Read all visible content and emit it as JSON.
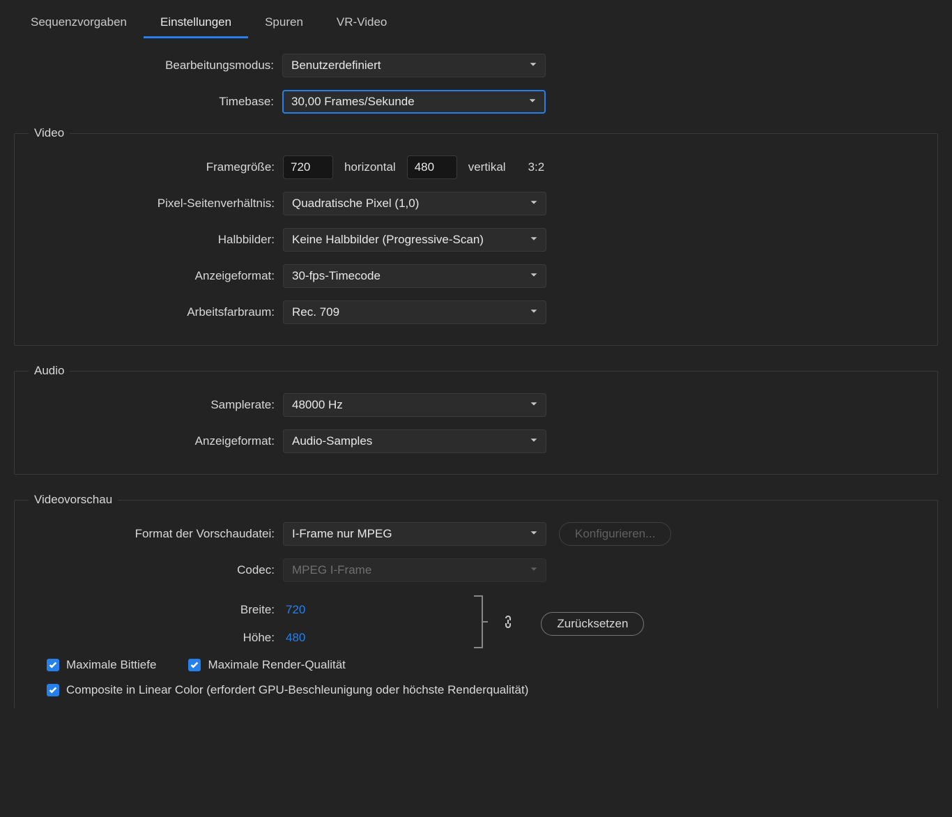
{
  "tabs": {
    "t0": "Sequenzvorgaben",
    "t1": "Einstellungen",
    "t2": "Spuren",
    "t3": "VR-Video"
  },
  "editing": {
    "mode_label": "Bearbeitungsmodus:",
    "mode_value": "Benutzerdefiniert",
    "timebase_label": "Timebase:",
    "timebase_value": "30,00  Frames/Sekunde"
  },
  "video": {
    "legend": "Video",
    "framesize_label": "Framegröße:",
    "width": "720",
    "horizontal": "horizontal",
    "height": "480",
    "vertical": "vertikal",
    "aspect": "3:2",
    "par_label": "Pixel-Seitenverhältnis:",
    "par_value": "Quadratische Pixel (1,0)",
    "fields_label": "Halbbilder:",
    "fields_value": "Keine Halbbilder (Progressive-Scan)",
    "display_label": "Anzeigeformat:",
    "display_value": "30-fps-Timecode",
    "colorspace_label": "Arbeitsfarbraum:",
    "colorspace_value": "Rec. 709"
  },
  "audio": {
    "legend": "Audio",
    "samplerate_label": "Samplerate:",
    "samplerate_value": "48000 Hz",
    "display_label": "Anzeigeformat:",
    "display_value": "Audio-Samples"
  },
  "preview": {
    "legend": "Videovorschau",
    "format_label": "Format der Vorschaudatei:",
    "format_value": "I-Frame nur MPEG",
    "configure": "Konfigurieren...",
    "codec_label": "Codec:",
    "codec_value": "MPEG I-Frame",
    "width_label": "Breite:",
    "width_value": "720",
    "height_label": "Höhe:",
    "height_value": "480",
    "reset": "Zurücksetzen"
  },
  "checks": {
    "bitdepth": "Maximale Bittiefe",
    "renderq": "Maximale Render-Qualität",
    "linear": "Composite in Linear Color (erfordert GPU-Beschleunigung oder höchste Renderqualität)"
  }
}
